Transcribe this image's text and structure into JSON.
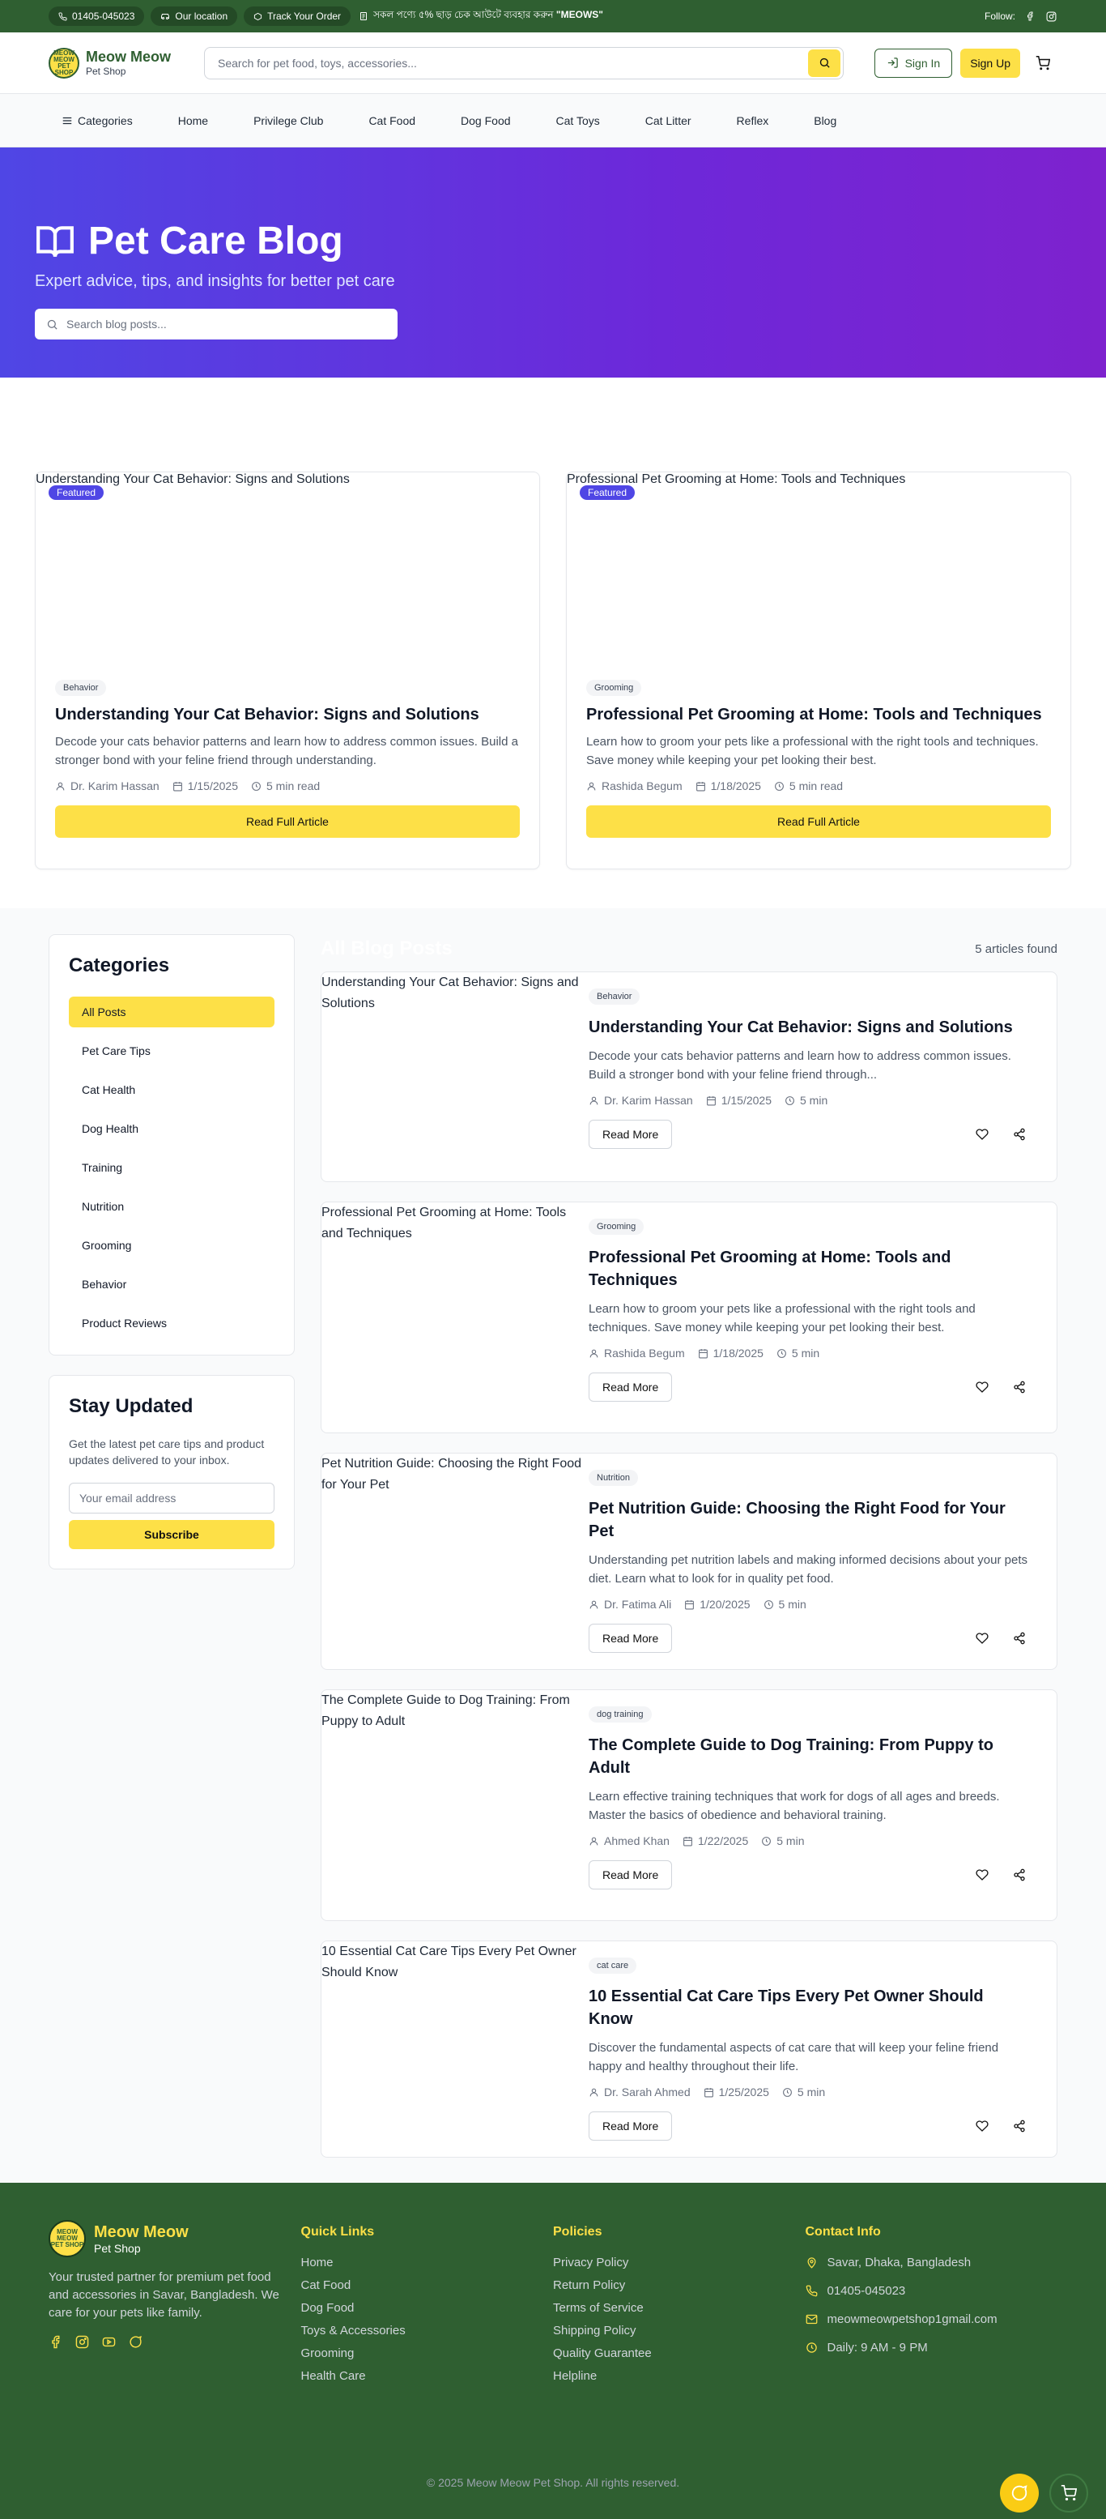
{
  "topbar": {
    "phone": "01405-045023",
    "location": "Our location",
    "track": "Track Your Order",
    "promo_text": "সকল পণ্যে ৫% ছাড় চেক আউটে ব্যবহার করুন ",
    "promo_code": "\"MEOWS\"",
    "follow": "Follow:"
  },
  "header": {
    "logo_badge": "MEOW MEOW PET SHOP",
    "brand": "Meow Meow",
    "sub": "Pet Shop",
    "search_placeholder": "Search for pet food, toys, accessories...",
    "signin": "Sign In",
    "signup": "Sign Up"
  },
  "nav": {
    "categories": "Categories",
    "items": [
      "Home",
      "Privilege Club",
      "Cat Food",
      "Dog Food",
      "Cat Toys",
      "Cat Litter",
      "Reflex",
      "Blog"
    ]
  },
  "hero": {
    "title": "Pet Care Blog",
    "subtitle": "Expert advice, tips, and insights for better pet care",
    "search_placeholder": "Search blog posts..."
  },
  "featured": [
    {
      "img_alt": "Understanding Your Cat Behavior: Signs and Solutions",
      "badge": "Featured",
      "tag": "Behavior",
      "title": "Understanding Your Cat Behavior: Signs and Solutions",
      "excerpt": "Decode your cats behavior patterns and learn how to address common issues. Build a stronger bond with your feline friend through understanding.",
      "author": "Dr. Karim Hassan",
      "date": "1/15/2025",
      "read": "5 min read",
      "cta": "Read Full Article"
    },
    {
      "img_alt": "Professional Pet Grooming at Home: Tools and Techniques",
      "badge": "Featured",
      "tag": "Grooming",
      "title": "Professional Pet Grooming at Home: Tools and Techniques",
      "excerpt": "Learn how to groom your pets like a professional with the right tools and techniques. Save money while keeping your pet looking their best.",
      "author": "Rashida Begum",
      "date": "1/18/2025",
      "read": "5 min read",
      "cta": "Read Full Article"
    }
  ],
  "sidebar": {
    "categories_title": "Categories",
    "categories": [
      "All Posts",
      "Pet Care Tips",
      "Cat Health",
      "Dog Health",
      "Training",
      "Nutrition",
      "Grooming",
      "Behavior",
      "Product Reviews"
    ],
    "newsletter_title": "Stay Updated",
    "newsletter_text": "Get the latest pet care tips and product updates delivered to your inbox.",
    "email_placeholder": "Your email address",
    "subscribe": "Subscribe"
  },
  "articles": {
    "title": "All Blog Posts",
    "count": "5 articles found",
    "read_more": "Read More",
    "items": [
      {
        "img_alt": "Understanding Your Cat Behavior: Signs and Solutions",
        "tag": "Behavior",
        "title": "Understanding Your Cat Behavior: Signs and Solutions",
        "excerpt": "Decode your cats behavior patterns and learn how to address common issues. Build a stronger bond with your feline friend through...",
        "author": "Dr. Karim Hassan",
        "date": "1/15/2025",
        "read": "5 min"
      },
      {
        "img_alt": "Professional Pet Grooming at Home: Tools and Techniques",
        "tag": "Grooming",
        "title": "Professional Pet Grooming at Home: Tools and Techniques",
        "excerpt": "Learn how to groom your pets like a professional with the right tools and techniques. Save money while keeping your pet looking their best.",
        "author": "Rashida Begum",
        "date": "1/18/2025",
        "read": "5 min"
      },
      {
        "img_alt": "Pet Nutrition Guide: Choosing the Right Food for Your Pet",
        "tag": "Nutrition",
        "title": "Pet Nutrition Guide: Choosing the Right Food for Your Pet",
        "excerpt": "Understanding pet nutrition labels and making informed decisions about your pets diet. Learn what to look for in quality pet food.",
        "author": "Dr. Fatima Ali",
        "date": "1/20/2025",
        "read": "5 min"
      },
      {
        "img_alt": "The Complete Guide to Dog Training: From Puppy to Adult",
        "tag": "dog training",
        "title": "The Complete Guide to Dog Training: From Puppy to Adult",
        "excerpt": "Learn effective training techniques that work for dogs of all ages and breeds. Master the basics of obedience and behavioral training.",
        "author": "Ahmed Khan",
        "date": "1/22/2025",
        "read": "5 min"
      },
      {
        "img_alt": "10 Essential Cat Care Tips Every Pet Owner Should Know",
        "tag": "cat care",
        "title": "10 Essential Cat Care Tips Every Pet Owner Should Know",
        "excerpt": "Discover the fundamental aspects of cat care that will keep your feline friend happy and healthy throughout their life.",
        "author": "Dr. Sarah Ahmed",
        "date": "1/25/2025",
        "read": "5 min"
      }
    ]
  },
  "footer": {
    "brand": "Meow Meow",
    "sub": "Pet Shop",
    "desc": "Your trusted partner for premium pet food and accessories in Savar, Bangladesh. We care for your pets like family.",
    "quick_title": "Quick Links",
    "quick": [
      "Home",
      "Cat Food",
      "Dog Food",
      "Toys & Accessories",
      "Grooming",
      "Health Care"
    ],
    "policies_title": "Policies",
    "policies": [
      "Privacy Policy",
      "Return Policy",
      "Terms of Service",
      "Shipping Policy",
      "Quality Guarantee",
      "Helpline"
    ],
    "contact_title": "Contact Info",
    "address": "Savar, Dhaka, Bangladesh",
    "phone": "01405-045023",
    "email": "meowmeowpetshop1gmail.com",
    "hours": "Daily: 9 AM - 9 PM",
    "copyright": "© 2025 Meow Meow Pet Shop. All rights reserved."
  },
  "colors": {
    "brand_green": "#2f5f31",
    "accent_yellow": "#fde047",
    "hero_gradient_start": "#4f46e5",
    "hero_gradient_end": "#7e22ce"
  }
}
